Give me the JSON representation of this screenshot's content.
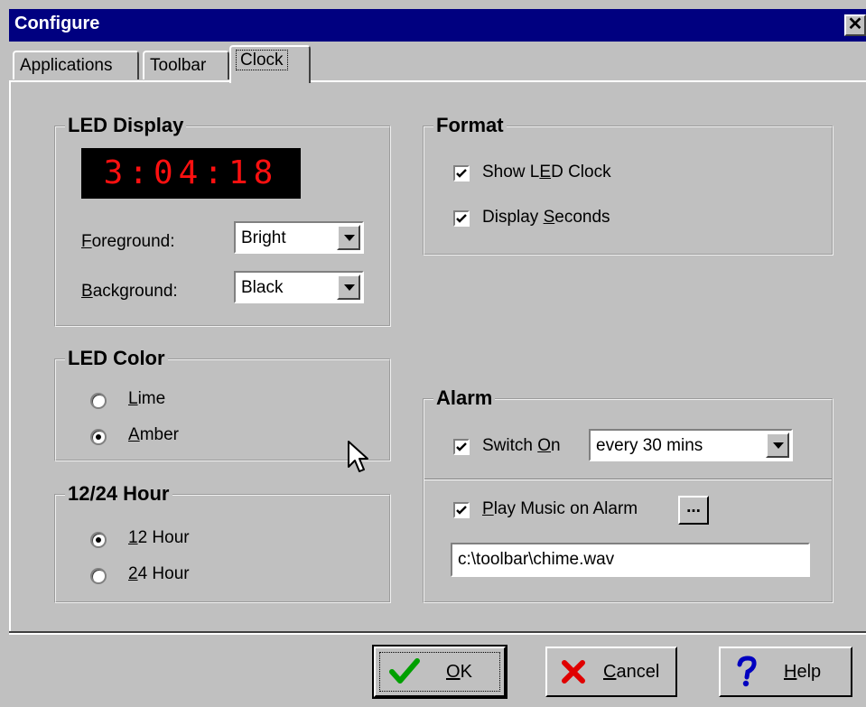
{
  "window": {
    "title": "Configure",
    "close_glyph": "✕"
  },
  "tabs": [
    {
      "label": "Applications",
      "active": false
    },
    {
      "label": "Toolbar",
      "active": false
    },
    {
      "label": "Clock",
      "active": true
    }
  ],
  "led_display": {
    "legend": "LED Display",
    "time": "3:04:18",
    "led_color_hex": "#ff1010",
    "foreground": {
      "mnemonic": "F",
      "rest": "oreground:",
      "value": "Bright"
    },
    "background": {
      "mnemonic": "B",
      "rest": "ackground:",
      "value": "Black"
    }
  },
  "led_color": {
    "legend": "LED Color",
    "options": [
      {
        "mnemonic": "L",
        "rest": "ime",
        "selected": false
      },
      {
        "mnemonic": "A",
        "rest": "mber",
        "selected": true
      }
    ]
  },
  "hour_mode": {
    "legend": "12/24 Hour",
    "options": [
      {
        "mnemonic": "1",
        "rest": "2 Hour",
        "selected": true
      },
      {
        "mnemonic": "2",
        "rest": "4 Hour",
        "selected": false
      }
    ]
  },
  "format": {
    "legend": "Format",
    "show_led": {
      "pre": "Show L",
      "mnemonic": "E",
      "post": "D Clock",
      "checked": true
    },
    "display_seconds": {
      "pre": "Display ",
      "mnemonic": "S",
      "post": "econds",
      "checked": true
    }
  },
  "alarm": {
    "legend": "Alarm",
    "switch_on": {
      "pre": "Switch ",
      "mnemonic": "O",
      "post": "n",
      "checked": true,
      "interval": "every 30 mins"
    },
    "play_music": {
      "mnemonic": "P",
      "post": "lay Music on Alarm",
      "checked": true,
      "browse_label": "..."
    },
    "sound_file": "c:\\toolbar\\chime.wav"
  },
  "buttons": {
    "ok": {
      "mnemonic": "O",
      "rest": "K",
      "icon": "check-icon",
      "icon_color": "#00a000"
    },
    "cancel": {
      "mnemonic": "C",
      "rest": "ancel",
      "icon": "x-icon",
      "icon_color": "#e00000"
    },
    "help": {
      "mnemonic": "H",
      "rest": "elp",
      "icon": "question-icon",
      "icon_color": "#0000c0"
    }
  }
}
